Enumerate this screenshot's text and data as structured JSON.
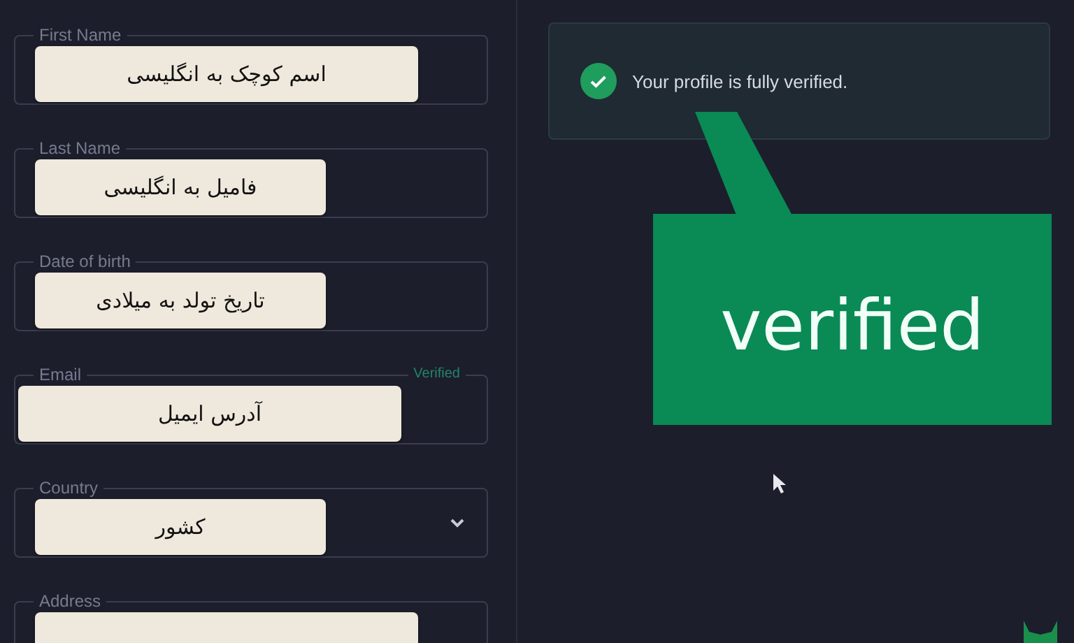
{
  "fields": [
    {
      "label": "First Name",
      "kind": "text",
      "note": {
        "text": "اسم کوچک به انگلیسی"
      }
    },
    {
      "label": "Last Name",
      "kind": "text",
      "note": {
        "text": "فامیل به انگلیسی"
      }
    },
    {
      "label": "Date of birth",
      "kind": "text",
      "note": {
        "text": "تاریخ تولد به میلادی"
      }
    },
    {
      "label": "Email",
      "kind": "text",
      "badge": "Verified",
      "note": {
        "text": "آدرس ایمیل"
      }
    },
    {
      "label": "Country",
      "kind": "select",
      "note": {
        "text": "کشور"
      }
    },
    {
      "label": "Address",
      "kind": "text",
      "covered": true
    }
  ],
  "status_card": {
    "message": "Your profile is fully verified."
  },
  "callout": {
    "text": "verified"
  }
}
